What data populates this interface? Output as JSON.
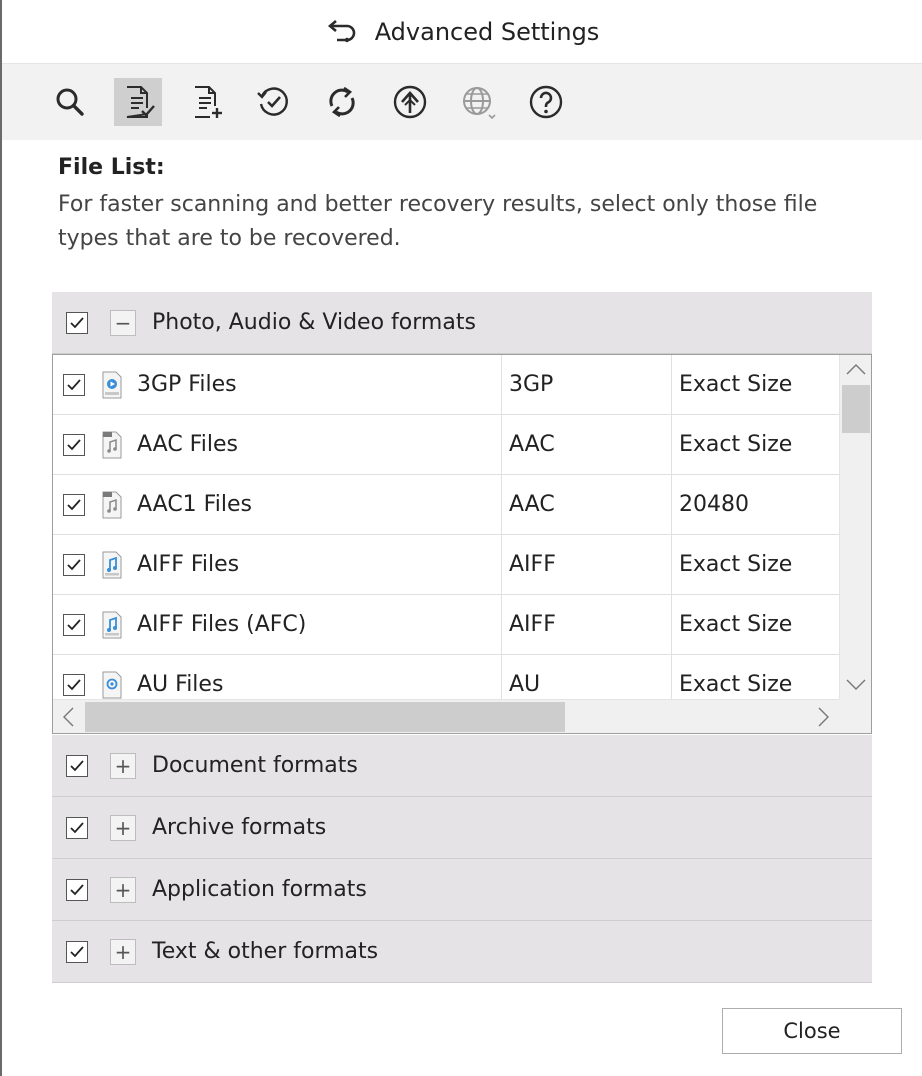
{
  "header": {
    "title": "Advanced Settings",
    "back_icon": "back-arrow-icon"
  },
  "toolbar": {
    "items": [
      {
        "name": "search",
        "icon": "search-icon",
        "active": false
      },
      {
        "name": "file-list",
        "icon": "file-list-check-icon",
        "active": true
      },
      {
        "name": "add-file-type",
        "icon": "add-file-icon",
        "active": false
      },
      {
        "name": "resume-recovery",
        "icon": "clock-check-icon",
        "active": false
      },
      {
        "name": "update",
        "icon": "refresh-icon",
        "active": false
      },
      {
        "name": "upgrade",
        "icon": "upload-arrow-icon",
        "active": false
      },
      {
        "name": "language",
        "icon": "globe-icon",
        "active": false,
        "disabled": true
      },
      {
        "name": "help",
        "icon": "help-icon",
        "active": false
      }
    ]
  },
  "section": {
    "title": "File List:",
    "description": "For faster scanning and better recovery results, select only those file types that are to be recovered."
  },
  "groups": [
    {
      "label": "Photo, Audio & Video formats",
      "checked": true,
      "expanded": true,
      "expander": "−"
    },
    {
      "label": "Document formats",
      "checked": true,
      "expanded": false,
      "expander": "+"
    },
    {
      "label": "Archive formats",
      "checked": true,
      "expanded": false,
      "expander": "+"
    },
    {
      "label": "Application formats",
      "checked": true,
      "expanded": false,
      "expander": "+"
    },
    {
      "label": "Text & other formats",
      "checked": true,
      "expanded": false,
      "expander": "+"
    }
  ],
  "files": [
    {
      "name": "3GP Files",
      "ext": "3GP",
      "size": "Exact Size",
      "checked": true,
      "icon": "video-file-icon"
    },
    {
      "name": "AAC Files",
      "ext": "AAC",
      "size": "Exact Size",
      "checked": true,
      "icon": "audio-file-icon"
    },
    {
      "name": "AAC1 Files",
      "ext": "AAC",
      "size": "20480",
      "checked": true,
      "icon": "audio-file-icon"
    },
    {
      "name": "AIFF Files",
      "ext": "AIFF",
      "size": "Exact Size",
      "checked": true,
      "icon": "music-file-icon"
    },
    {
      "name": "AIFF Files (AFC)",
      "ext": "AIFF",
      "size": "Exact Size",
      "checked": true,
      "icon": "music-file-icon"
    },
    {
      "name": "AU Files",
      "ext": "AU",
      "size": "Exact Size",
      "checked": true,
      "icon": "au-file-icon"
    }
  ],
  "buttons": {
    "close": "Close"
  },
  "colors": {
    "group_bg": "#e6e3e6",
    "toolbar_bg": "#f2f2f2",
    "active_tool": "#cfcfcf",
    "icon_stroke": "#2b2b2b"
  }
}
